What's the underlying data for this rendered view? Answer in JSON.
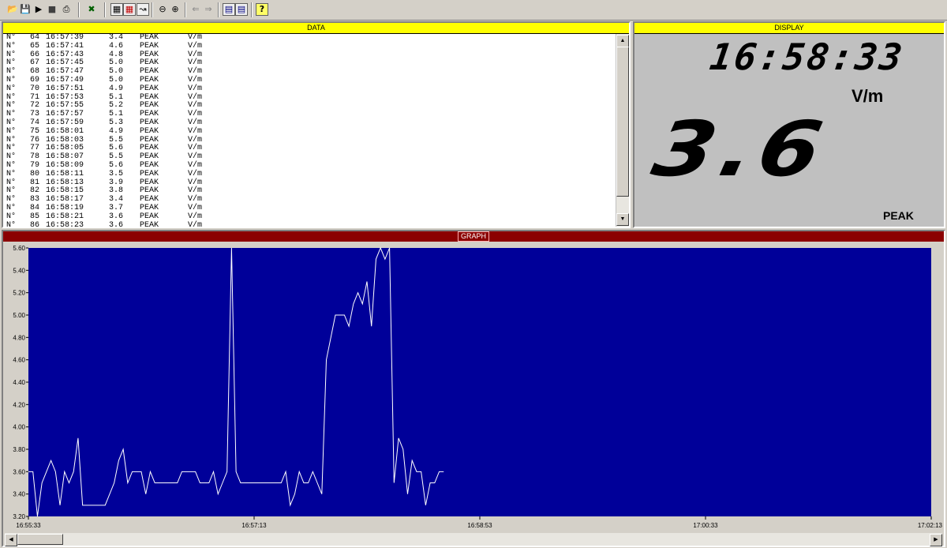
{
  "toolbar": {
    "icons": [
      "open-folder-icon",
      "save-icon",
      "play-icon",
      "stop-icon",
      "print-icon",
      "probe-icon",
      "grid-icon",
      "table-icon",
      "chart-icon",
      "zoom-out-icon",
      "zoom-in-icon",
      "scroll-left-icon",
      "scroll-right-icon",
      "tile-horizontal-icon",
      "tile-vertical-icon",
      "help-icon"
    ]
  },
  "data_panel": {
    "title": "DATA",
    "rows": [
      {
        "n": "N°",
        "idx": "64",
        "time": "16:57:39",
        "value": "3.4",
        "mode": "PEAK",
        "unit": "V/m"
      },
      {
        "n": "N°",
        "idx": "65",
        "time": "16:57:41",
        "value": "4.6",
        "mode": "PEAK",
        "unit": "V/m"
      },
      {
        "n": "N°",
        "idx": "66",
        "time": "16:57:43",
        "value": "4.8",
        "mode": "PEAK",
        "unit": "V/m"
      },
      {
        "n": "N°",
        "idx": "67",
        "time": "16:57:45",
        "value": "5.0",
        "mode": "PEAK",
        "unit": "V/m"
      },
      {
        "n": "N°",
        "idx": "68",
        "time": "16:57:47",
        "value": "5.0",
        "mode": "PEAK",
        "unit": "V/m"
      },
      {
        "n": "N°",
        "idx": "69",
        "time": "16:57:49",
        "value": "5.0",
        "mode": "PEAK",
        "unit": "V/m"
      },
      {
        "n": "N°",
        "idx": "70",
        "time": "16:57:51",
        "value": "4.9",
        "mode": "PEAK",
        "unit": "V/m"
      },
      {
        "n": "N°",
        "idx": "71",
        "time": "16:57:53",
        "value": "5.1",
        "mode": "PEAK",
        "unit": "V/m"
      },
      {
        "n": "N°",
        "idx": "72",
        "time": "16:57:55",
        "value": "5.2",
        "mode": "PEAK",
        "unit": "V/m"
      },
      {
        "n": "N°",
        "idx": "73",
        "time": "16:57:57",
        "value": "5.1",
        "mode": "PEAK",
        "unit": "V/m"
      },
      {
        "n": "N°",
        "idx": "74",
        "time": "16:57:59",
        "value": "5.3",
        "mode": "PEAK",
        "unit": "V/m"
      },
      {
        "n": "N°",
        "idx": "75",
        "time": "16:58:01",
        "value": "4.9",
        "mode": "PEAK",
        "unit": "V/m"
      },
      {
        "n": "N°",
        "idx": "76",
        "time": "16:58:03",
        "value": "5.5",
        "mode": "PEAK",
        "unit": "V/m"
      },
      {
        "n": "N°",
        "idx": "77",
        "time": "16:58:05",
        "value": "5.6",
        "mode": "PEAK",
        "unit": "V/m"
      },
      {
        "n": "N°",
        "idx": "78",
        "time": "16:58:07",
        "value": "5.5",
        "mode": "PEAK",
        "unit": "V/m"
      },
      {
        "n": "N°",
        "idx": "79",
        "time": "16:58:09",
        "value": "5.6",
        "mode": "PEAK",
        "unit": "V/m"
      },
      {
        "n": "N°",
        "idx": "80",
        "time": "16:58:11",
        "value": "3.5",
        "mode": "PEAK",
        "unit": "V/m"
      },
      {
        "n": "N°",
        "idx": "81",
        "time": "16:58:13",
        "value": "3.9",
        "mode": "PEAK",
        "unit": "V/m"
      },
      {
        "n": "N°",
        "idx": "82",
        "time": "16:58:15",
        "value": "3.8",
        "mode": "PEAK",
        "unit": "V/m"
      },
      {
        "n": "N°",
        "idx": "83",
        "time": "16:58:17",
        "value": "3.4",
        "mode": "PEAK",
        "unit": "V/m"
      },
      {
        "n": "N°",
        "idx": "84",
        "time": "16:58:19",
        "value": "3.7",
        "mode": "PEAK",
        "unit": "V/m"
      },
      {
        "n": "N°",
        "idx": "85",
        "time": "16:58:21",
        "value": "3.6",
        "mode": "PEAK",
        "unit": "V/m"
      },
      {
        "n": "N°",
        "idx": "86",
        "time": "16:58:23",
        "value": "3.6",
        "mode": "PEAK",
        "unit": "V/m"
      }
    ],
    "scroll_up_icon": "scroll-up-icon",
    "scroll_down_icon": "scroll-down-icon"
  },
  "display_panel": {
    "title": "DISPLAY",
    "time": "16:58:33",
    "unit": "V/m",
    "value": "3.6",
    "mode": "PEAK"
  },
  "graph_panel": {
    "title": "GRAPH",
    "colors": {
      "background": "#000099",
      "line": "#ffffff",
      "frame": "#d4d0c8"
    },
    "scroll_left_icon": "scroll-left-icon",
    "scroll_right_icon": "scroll-right-icon"
  },
  "chart_data": {
    "type": "line",
    "title": "",
    "xlabel": "",
    "ylabel": "",
    "x_tick_labels": [
      "16:55:33",
      "16:57:13",
      "16:58:53",
      "17:00:33",
      "17:02:13"
    ],
    "x_range_seconds": [
      0,
      400
    ],
    "y_tick_labels": [
      "3.20",
      "3.40",
      "3.60",
      "3.80",
      "4.00",
      "4.20",
      "4.40",
      "4.60",
      "4.80",
      "5.00",
      "5.20",
      "5.40",
      "5.60"
    ],
    "ylim": [
      3.2,
      5.6
    ],
    "grid": false,
    "sample_interval_s": 2,
    "series": [
      {
        "values": [
          3.6,
          3.6,
          3.2,
          3.5,
          3.6,
          3.7,
          3.6,
          3.3,
          3.6,
          3.5,
          3.6,
          3.9,
          3.3,
          3.3,
          3.3,
          3.3,
          3.3,
          3.3,
          3.4,
          3.5,
          3.7,
          3.8,
          3.5,
          3.6,
          3.6,
          3.6,
          3.4,
          3.6,
          3.5,
          3.5,
          3.5,
          3.5,
          3.5,
          3.5,
          3.6,
          3.6,
          3.6,
          3.6,
          3.5,
          3.5,
          3.5,
          3.6,
          3.4,
          3.5,
          3.6,
          5.6,
          3.6,
          3.5,
          3.5,
          3.5,
          3.5,
          3.5,
          3.5,
          3.5,
          3.5,
          3.5,
          3.5,
          3.6,
          3.3,
          3.4,
          3.6,
          3.5,
          3.5,
          3.6,
          3.5,
          3.4,
          4.6,
          4.8,
          5.0,
          5.0,
          5.0,
          4.9,
          5.1,
          5.2,
          5.1,
          5.3,
          4.9,
          5.5,
          5.6,
          5.5,
          5.6,
          3.5,
          3.9,
          3.8,
          3.4,
          3.7,
          3.6,
          3.6,
          3.3,
          3.5,
          3.5,
          3.6,
          3.6
        ]
      }
    ]
  }
}
